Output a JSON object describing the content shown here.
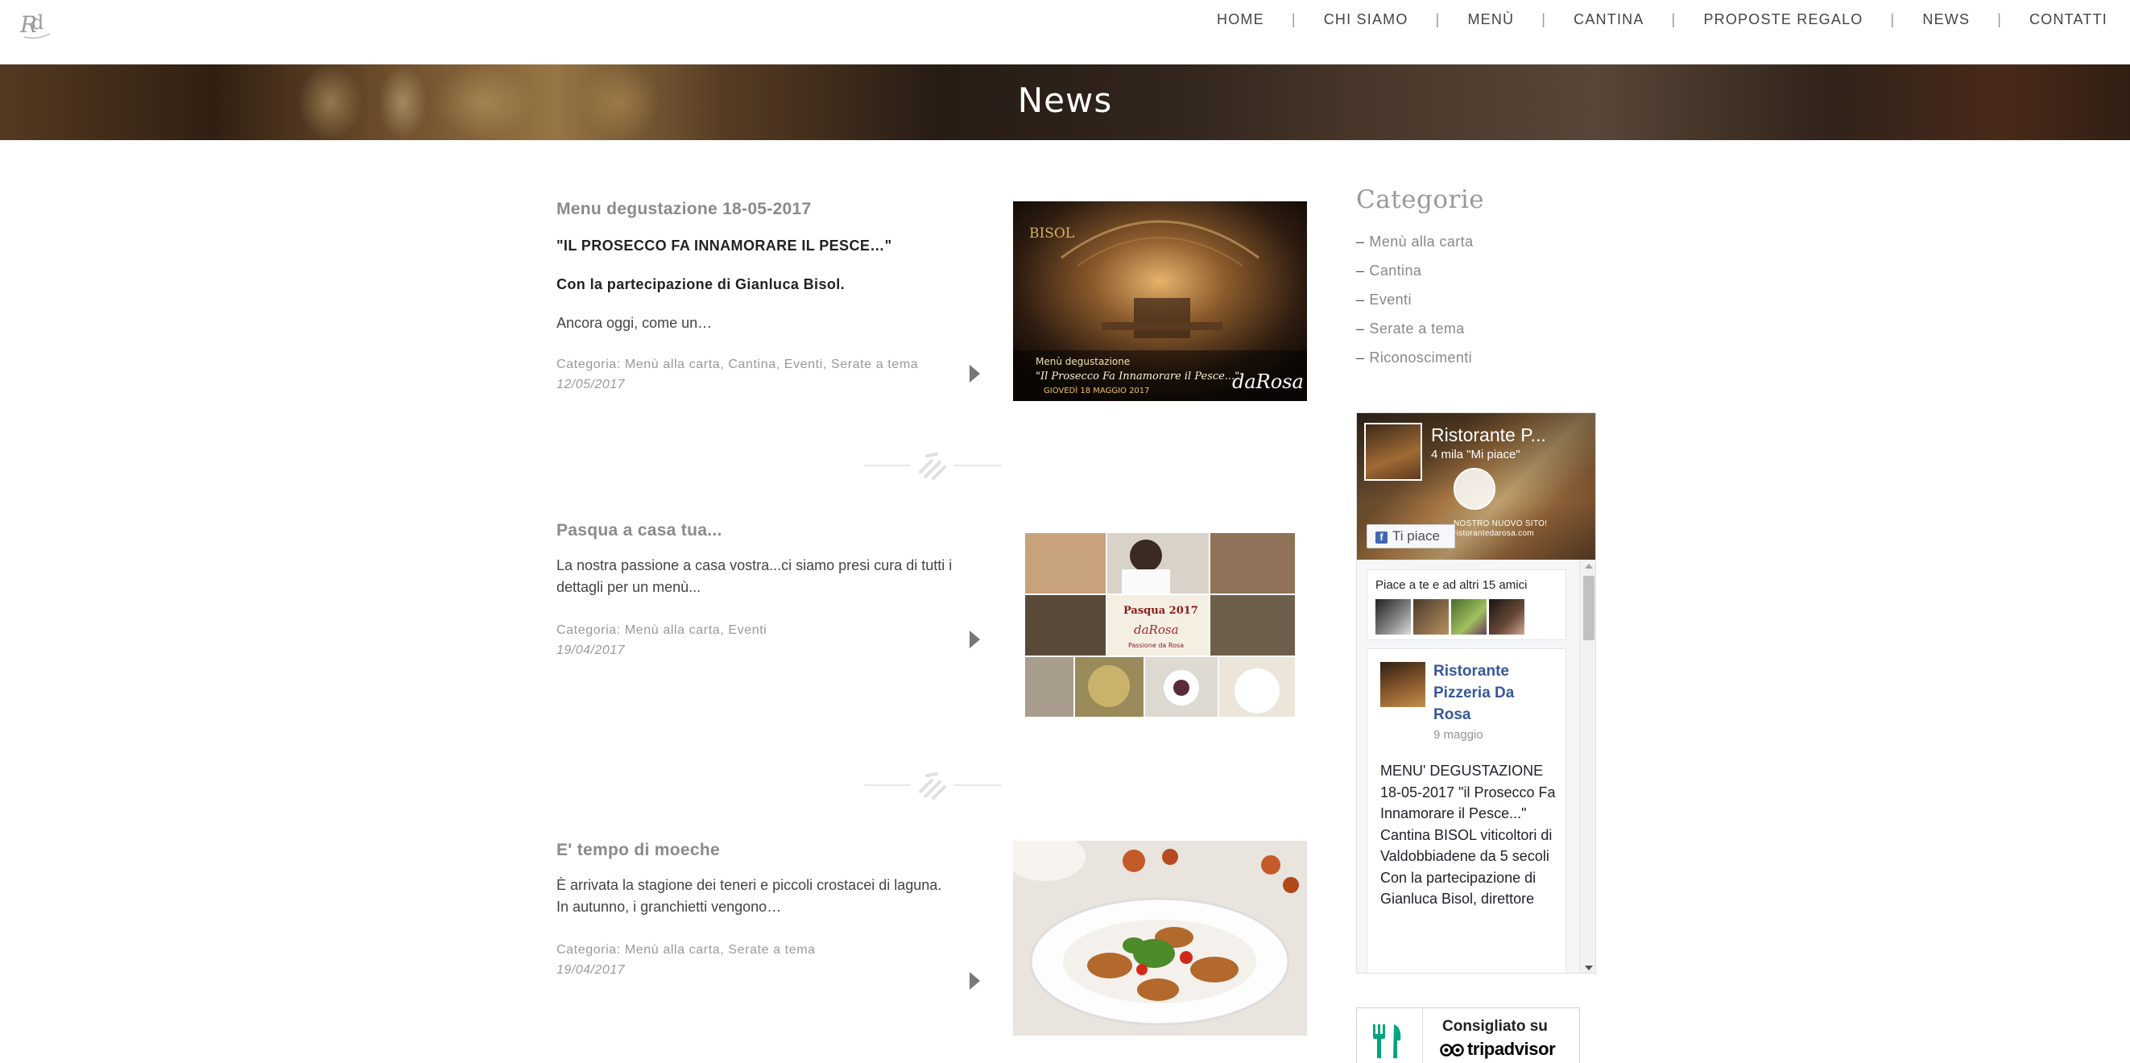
{
  "nav": {
    "items": [
      "HOME",
      "CHI SIAMO",
      "MENÙ",
      "CANTINA",
      "PROPOSTE REGALO",
      "NEWS",
      "CONTATTI"
    ]
  },
  "banner": {
    "title": "News"
  },
  "posts": [
    {
      "title": "Menu degustazione 18-05-2017",
      "lines": [
        "\"IL PROSECCO FA INNAMORARE IL PESCE…\"",
        "Con la partecipazione di Gianluca Bisol.",
        "Ancora oggi, come un…"
      ],
      "categories": "Categoria: Menù alla carta, Cantina, Eventi, Serate a tema",
      "date": "12/05/2017",
      "image": {
        "brand": "BISOL",
        "caption1": "Menù degustazione",
        "caption2": "\"Il Prosecco Fa Innamorare il Pesce...\"",
        "caption3": "GIOVEDÌ 18 MAGGIO 2017",
        "logo_text": "daRosa"
      }
    },
    {
      "title": "Pasqua a casa tua...",
      "text": "La nostra passione a casa vostra...ci siamo presi cura di tutti i dettagli per un menù...",
      "categories": "Categoria: Menù alla carta, Eventi",
      "date": "19/04/2017",
      "image": {
        "label1": "Pasqua 2017",
        "label2": "daRosa",
        "label3": "Passione da Rosa"
      }
    },
    {
      "title": "E' tempo di moeche",
      "text": "È arrivata la stagione dei teneri e piccoli crostacei di laguna.",
      "text2": "In autunno, i granchietti vengono…",
      "categories": "Categoria: Menù alla carta, Serate a tema",
      "date": "19/04/2017"
    }
  ],
  "sidebar": {
    "title": "Categorie",
    "categories": [
      "Menù alla carta",
      "Cantina",
      "Eventi",
      "Serate a tema",
      "Riconoscimenti"
    ]
  },
  "facebook": {
    "page_name": "Ristorante P...",
    "likes": "4 mila \"Mi piace\"",
    "cover_text_1": "NOSTRO NUOVO SITO!",
    "cover_text_2": "ristorantedarosa.com",
    "like_button": "Ti piace",
    "friends_text": "Piace a te e ad altri 15 amici",
    "post_author": "Ristorante Pizzeria Da Rosa",
    "post_date": "9 maggio",
    "post_text": "MENU' DEGUSTAZIONE 18-05-2017 \"il Prosecco Fa Innamorare il Pesce...\" Cantina BISOL viticoltori di Valdobbiadene da 5 secoli Con la partecipazione di Gianluca Bisol, direttore"
  },
  "tripadvisor": {
    "line1": "Consigliato su",
    "line2": "tripadvisor"
  },
  "colors": {
    "accent_link": "#365899",
    "text": "#555555",
    "facebook_blue": "#4267b2"
  }
}
